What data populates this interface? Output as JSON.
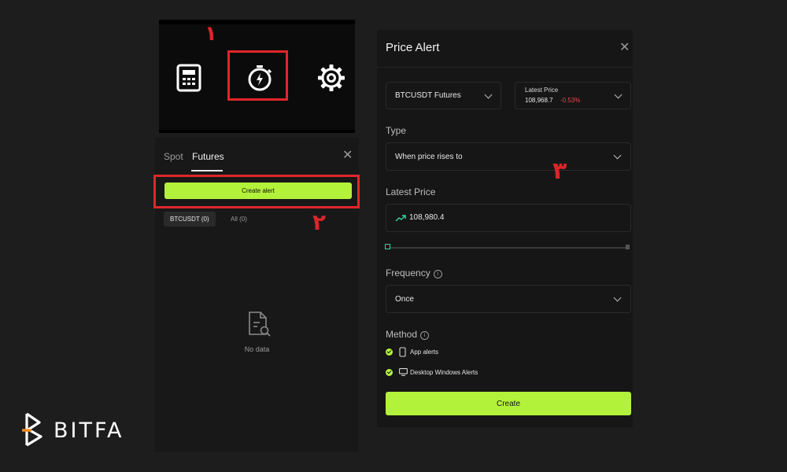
{
  "annotations": {
    "step1": "١",
    "step2": "٢",
    "step3": "٣"
  },
  "toolbar": {
    "icons": [
      "calculator-icon",
      "price-alert-stopwatch-icon",
      "gear-icon"
    ]
  },
  "alerts_panel": {
    "tabs": [
      {
        "label": "Spot"
      },
      {
        "label": "Futures",
        "active": true
      }
    ],
    "create_alert_label": "Create alert",
    "filters": [
      {
        "label": "BTCUSDT (0)",
        "selected": true
      },
      {
        "label": "All (0)"
      }
    ],
    "empty_text": "No data"
  },
  "price_alert": {
    "title": "Price Alert",
    "symbol": "BTCUSDT Futures",
    "latest_price_caption": "Latest Price",
    "latest_price_value": "108,968.7",
    "latest_price_change": "-0.53%",
    "type_label": "Type",
    "type_value": "When price rises to",
    "price_label": "Latest Price",
    "price_input_value": "108,980.4",
    "frequency_label": "Frequency",
    "frequency_value": "Once",
    "method_label": "Method",
    "methods": [
      {
        "label": "App alerts",
        "checked": true
      },
      {
        "label": "Desktop Windows Alerts",
        "checked": true
      }
    ],
    "create_label": "Create"
  },
  "brand": {
    "name": "BITFA"
  },
  "colors": {
    "accent": "#b3f23a",
    "highlight": "#e0262a",
    "negative": "#f0454a",
    "positive": "#37d39a"
  }
}
